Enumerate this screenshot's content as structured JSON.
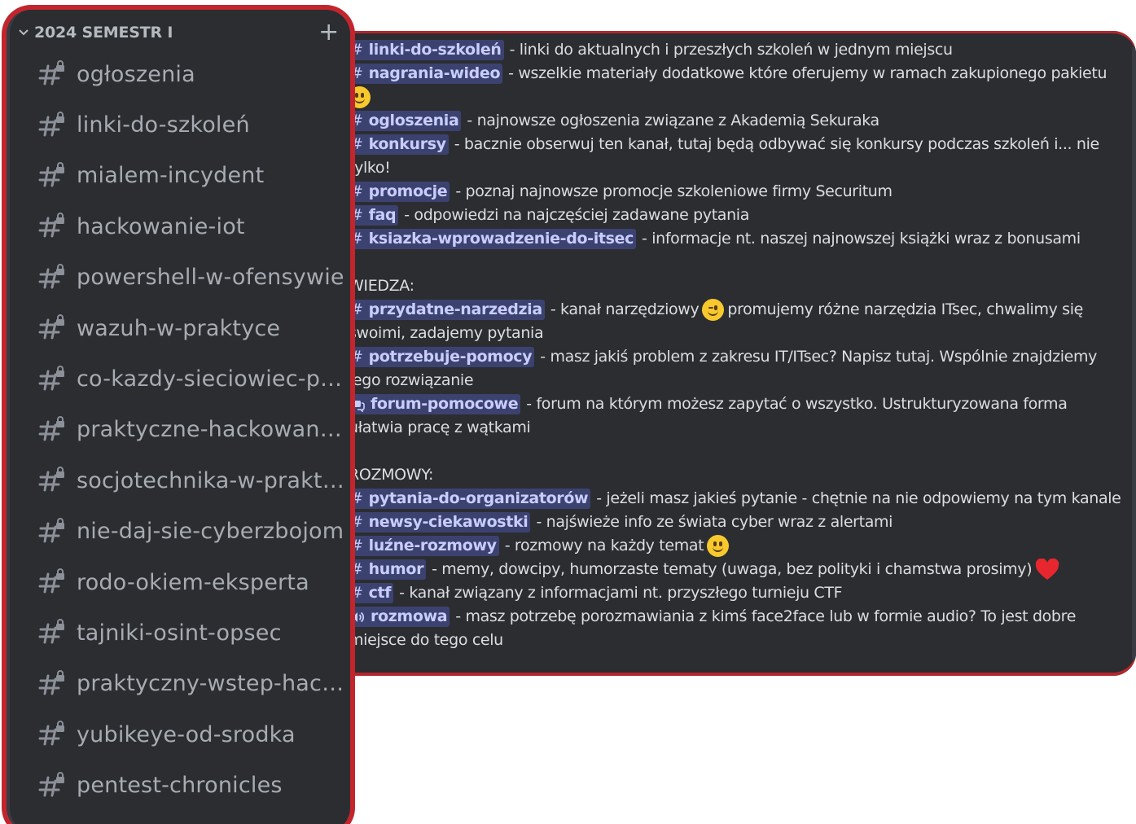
{
  "sidebar": {
    "category": "2024 SEMESTR I",
    "channels": [
      {
        "label": "ogłoszenia"
      },
      {
        "label": "linki-do-szkoleń"
      },
      {
        "label": "mialem-incydent"
      },
      {
        "label": "hackowanie-iot"
      },
      {
        "label": "powershell-w-ofensywie"
      },
      {
        "label": "wazuh-w-praktyce"
      },
      {
        "label": "co-kazdy-sieciowiec-po..."
      },
      {
        "label": "praktyczne-hackowanie..."
      },
      {
        "label": "socjotechnika-w-praktyce"
      },
      {
        "label": "nie-daj-sie-cyberzbojom"
      },
      {
        "label": "rodo-okiem-eksperta"
      },
      {
        "label": "tajniki-osint-opsec"
      },
      {
        "label": "praktyczny-wstep-hack..."
      },
      {
        "label": "yubikeye-od-srodka"
      },
      {
        "label": "pentest-chronicles"
      }
    ]
  },
  "message": {
    "l1_ch": "linki-do-szkoleń",
    "l1_text": "- linki do aktualnych i przeszłych szkoleń w jednym miejscu",
    "l2_ch": "nagrania-wideo",
    "l2_text": "- wszelkie materiały dodatkowe które oferujemy w ramach zakupionego pakietu",
    "l4_ch": "ogloszenia",
    "l4_text": "- najnowsze ogłoszenia związane z Akademią Sekuraka",
    "l5_ch": "konkursy",
    "l5_text": "- bacznie obserwuj ten kanał, tutaj będą odbywać się konkursy podczas szkoleń i... nie",
    "l6_text": "tylko!",
    "l7_ch": "promocje",
    "l7_text": "- poznaj najnowsze promocje szkoleniowe firmy Securitum",
    "l8_ch": "faq",
    "l8_text": "- odpowiedzi na najczęściej zadawane pytania",
    "l9_ch": "ksiazka-wprowadzenie-do-itsec",
    "l9_text": "- informacje nt. naszej najnowszej książki wraz z bonusami",
    "l11_text": "WIEDZA:",
    "l12_ch": "przydatne-narzedzia",
    "l12_text_a": "- kanał narzędziowy",
    "l12_text_b": "promujemy różne narzędzia ITsec, chwalimy się",
    "l13_text": "swoimi, zadajemy pytania",
    "l14_ch": "potrzebuje-pomocy",
    "l14_text": "- masz jakiś problem z zakresu IT/ITsec? Napisz tutaj. Wspólnie znajdziemy",
    "l15_text": "jego rozwiązanie",
    "l16_ch": "forum-pomocowe",
    "l16_text": "- forum na którym możesz zapytać o wszystko. Ustrukturyzowana forma",
    "l17_text": "ułatwia pracę z wątkami",
    "l19_text": "ROZMOWY:",
    "l20_ch": "pytania-do-organizatorów",
    "l20_text": "- jeżeli masz jakieś pytanie - chętnie na nie odpowiemy na tym kanale",
    "l21_ch": "newsy-ciekawostki",
    "l21_text": "- najświeże info ze świata cyber wraz z alertami",
    "l22_ch": "luźne-rozmowy",
    "l22_text": "- rozmowy na każdy temat",
    "l23_ch": "humor",
    "l23_text": "- memy, dowcipy, humorzaste tematy (uwaga, bez polityki i chamstwa prosimy)",
    "l24_ch": "ctf",
    "l24_text": "- kanał związany z informacjami nt. przyszłego turnieju CTF",
    "l25_ch": "rozmowa",
    "l25_text": "- masz potrzebę porozmawiania z kimś face2face lub w formie audio? To jest dobre",
    "l26_text": "miejsce do tego celu"
  },
  "icons": {
    "channel": "hashtag-lock-icon",
    "forum": "forum-icon",
    "voice": "speaker-icon",
    "smile": "smiling-face-emoji",
    "wink": "winking-face-emoji",
    "heart": "red-heart-emoji"
  },
  "colors": {
    "background": "#2b2d31",
    "accent_border": "#c2262c",
    "mention_bg": "#3c4270",
    "mention_fg": "#c9cdfb"
  }
}
